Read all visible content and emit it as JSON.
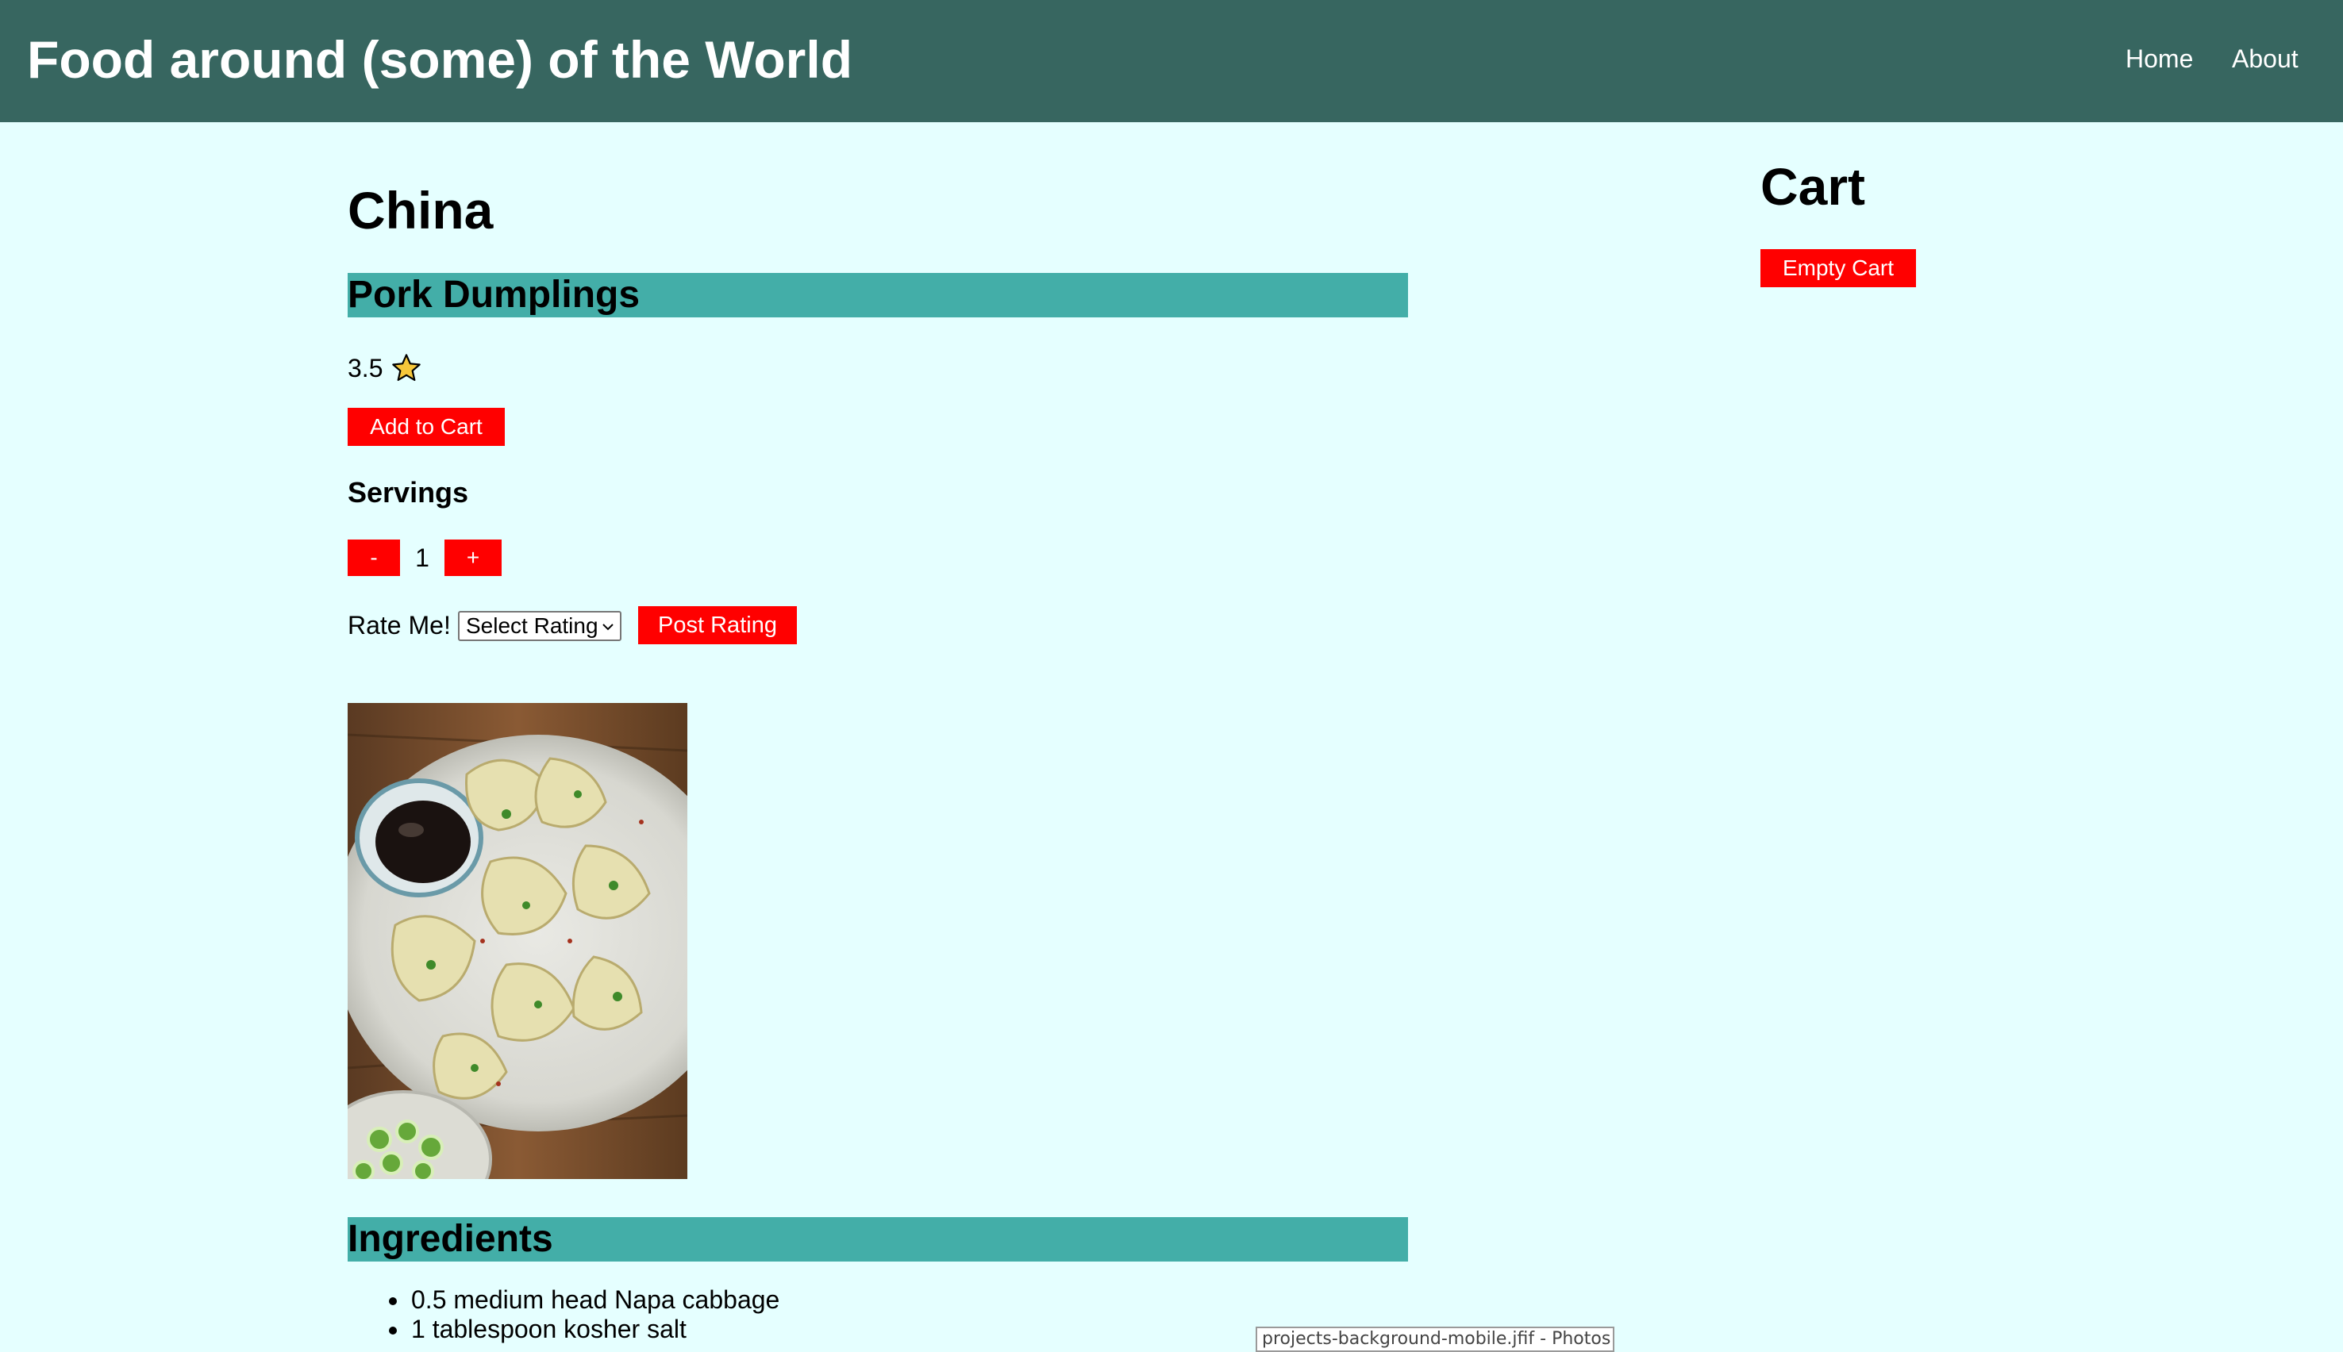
{
  "header": {
    "title": "Food around (some) of the World",
    "nav": {
      "home": "Home",
      "about": "About"
    }
  },
  "main": {
    "country": "China",
    "dish": {
      "name": "Pork Dumplings",
      "rating": "3.5",
      "rating_icon": "star-icon",
      "add_to_cart_label": "Add to Cart",
      "servings_heading": "Servings",
      "decrement_label": "-",
      "increment_label": "+",
      "servings_value": "1",
      "rate_label": "Rate Me!",
      "rating_select_value": "Select Rating",
      "post_rating_label": "Post Rating",
      "image_alt": "Pork dumplings on a plate with soy sauce"
    },
    "ingredients_heading": "Ingredients",
    "ingredients": [
      "0.5 medium head Napa cabbage",
      "1 tablespoon kosher salt"
    ]
  },
  "cart": {
    "heading": "Cart",
    "empty_label": "Empty Cart"
  },
  "tooltip": "projects-background-mobile.jfif - Photos",
  "colors": {
    "header_bg": "#376660",
    "page_bg": "#e5ffff",
    "section_bar": "#43aea8",
    "button": "#ff0000"
  }
}
